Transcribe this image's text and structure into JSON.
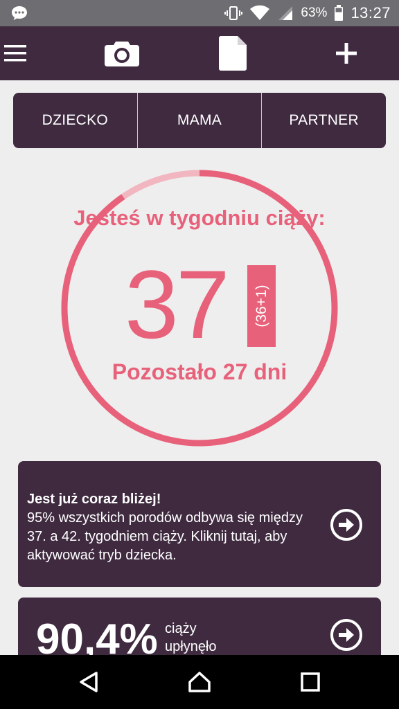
{
  "status_bar": {
    "battery_percent": "63%",
    "time": "13:27",
    "icons": [
      "message-icon",
      "vibrate-icon",
      "wifi-icon",
      "signal-icon",
      "battery-icon"
    ]
  },
  "toolbar": {
    "icons": [
      "menu-icon",
      "camera-icon",
      "document-icon",
      "plus-icon"
    ]
  },
  "tabs": [
    {
      "label": "DZIECKO"
    },
    {
      "label": "MAMA"
    },
    {
      "label": "PARTNER"
    }
  ],
  "progress": {
    "title": "Jesteś w tygodniu ciąży:",
    "week": "37",
    "week_detail": "(36+1)",
    "remaining": "Pozostało 27 dni",
    "ring_fraction": 0.904
  },
  "cards": {
    "info": {
      "heading": "Jest już coraz bliżej!",
      "body": "95% wszystkich porodów odbywa się między 37. a 42. tygodniem ciąży. Kliknij tutaj, aby aktywować tryb dziecka."
    },
    "progress": {
      "value": "90,4%",
      "label": "ciąży upłynęło"
    }
  },
  "colors": {
    "accent": "#e8617a",
    "accent_light": "#f2b6c0",
    "dark": "#3f2a40",
    "background": "#eeeeee"
  }
}
